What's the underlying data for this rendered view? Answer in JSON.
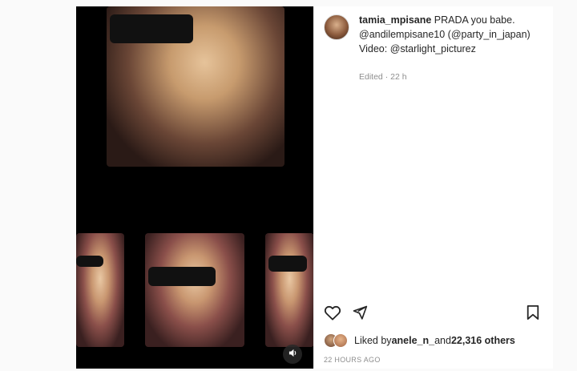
{
  "post": {
    "username": "tamia_mpisane",
    "caption_text": " PRADA you babe.",
    "mention_1": "@andilempisane10",
    "caption_mid": " (",
    "mention_2": "@party_in_japan",
    "caption_close": ")",
    "video_prefix": "Video: ",
    "mention_3": "@starlight_picturez",
    "edited_label": "Edited",
    "edited_sep": " · ",
    "edited_time": "22 h",
    "liked_by_prefix": "Liked by ",
    "liked_by_user": "anele_n_",
    "liked_by_mid": " and ",
    "liked_by_count": "22,316 others",
    "timestamp": "22 HOURS AGO"
  },
  "icons": {
    "like": "heart-icon",
    "share": "paper-plane-icon",
    "save": "bookmark-icon",
    "sound": "speaker-icon"
  }
}
